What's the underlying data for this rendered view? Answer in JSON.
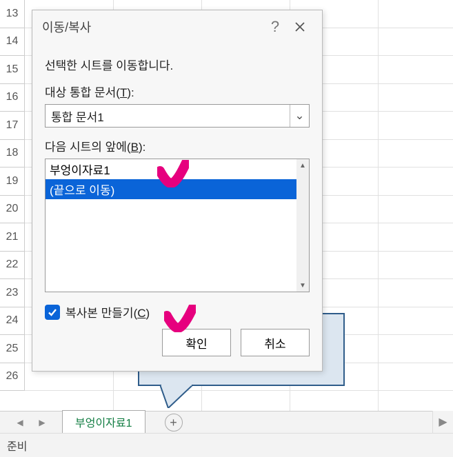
{
  "grid": {
    "rows": [
      "13",
      "14",
      "15",
      "16",
      "17",
      "18",
      "19",
      "20",
      "21",
      "22",
      "23",
      "24",
      "25",
      "26"
    ]
  },
  "dialog": {
    "title": "이동/복사",
    "help_char": "?",
    "msg": "선택한 시트를 이동합니다.",
    "workbook_label_pre": "대상 통합 문서(",
    "workbook_label_shortcut": "T",
    "workbook_label_post": "):",
    "workbook_value": "통합 문서1",
    "before_label_pre": "다음 시트의 앞에(",
    "before_label_shortcut": "B",
    "before_label_post": "):",
    "list": {
      "items": [
        {
          "label": "부엉이자료1",
          "selected": false
        },
        {
          "label": "(끝으로 이동)",
          "selected": true
        }
      ]
    },
    "copy_label_pre": "복사본 만들기(",
    "copy_label_shortcut": "C",
    "copy_label_post": ")",
    "copy_checked": true,
    "ok": "확인",
    "cancel": "취소"
  },
  "tabs": {
    "active": "부엉이자료1"
  },
  "status": {
    "text": "준비"
  },
  "icons": {
    "chevron_down": "⌄",
    "triangle_up": "▲",
    "triangle_down": "▼",
    "triangle_left": "◀",
    "triangle_right": "▶",
    "plus": "+"
  }
}
